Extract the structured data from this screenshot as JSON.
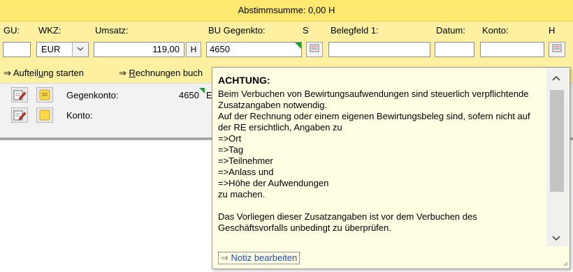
{
  "summary": {
    "text": "Abstimmsumme: 0,00 H"
  },
  "labels": {
    "gu": "GU:",
    "wkz": "WKZ:",
    "umsatz": "Umsatz:",
    "bu_gegenkto": "BU Gegenkto:",
    "s": "S",
    "belegfeld1": "Belegfeld 1:",
    "datum": "Datum:",
    "konto": "Konto:",
    "h": "H"
  },
  "inputs": {
    "gu_value": "",
    "currency_value": "EUR",
    "umsatz_value": "119,00",
    "soll_haben": "H",
    "bu_gegenkto_value": "4650",
    "belegfeld1_value": "",
    "datum_value": "",
    "konto_value": ""
  },
  "links": {
    "aufteilung": {
      "arrow": "⇒",
      "pre": "Aufteil",
      "u": "u",
      "post": "ng starten"
    },
    "rechnungen": {
      "arrow": "⇒",
      "pre": "",
      "u": "R",
      "post": "echnungen buch"
    }
  },
  "rows": {
    "gegenkonto_label": "Gegenkonto:",
    "gegenkonto_value": "4650",
    "gegenkonto_suffix": "E",
    "konto_label": "Konto:"
  },
  "popup": {
    "title": "ACHTUNG:",
    "lines": [
      "Beim Verbuchen von Bewirtungsaufwendungen sind steuerlich verpflichtende",
      "Zusatzangaben notwendig.",
      "Auf der Rechnung oder einem eigenen Bewirtungsbeleg sind, sofern nicht auf",
      "der RE ersichtlich, Angaben zu",
      "=>Ort",
      "=>Tag",
      "=>Teilnehmer",
      "=>Anlass und",
      "=>Höhe der Aufwendungen",
      "zu machen.",
      "",
      "Das Vorliegen dieser Zusatzangaben ist vor dem Verbuchen des",
      "Geschäftsvorfalls unbedingt zu überprüfen."
    ],
    "note_link_arrow": "⇒",
    "note_link_label": "Notiz bearbeiten"
  },
  "colors": {
    "header": "#ffe870",
    "band": "#fdf0a0",
    "popup_bg": "#fffde2",
    "marker_green": "#1f9e3a",
    "link_blue": "#1a4fb5"
  }
}
